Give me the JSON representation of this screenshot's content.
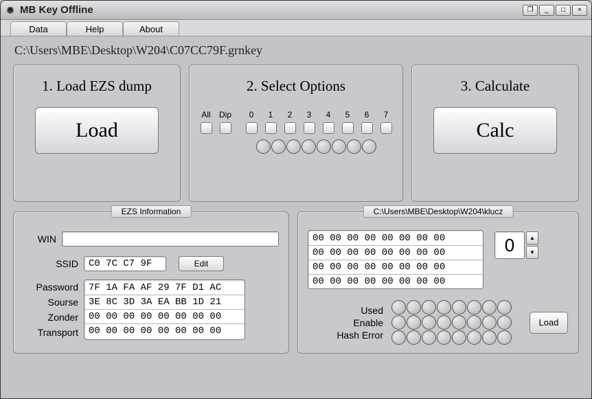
{
  "window": {
    "title": "MB Key Offline",
    "buttons": {
      "b1": "❐",
      "min": "_",
      "max": "□",
      "close": "×"
    }
  },
  "menu": {
    "data": "Data",
    "help": "Help",
    "about": "About"
  },
  "path": "C:\\Users\\MBE\\Desktop\\W204\\C07CC79F.grnkey",
  "panels": {
    "load": {
      "title": "1. Load EZS dump",
      "button": "Load"
    },
    "opts": {
      "title": "2. Select Options",
      "heads": {
        "all": "All",
        "dip": "Dip",
        "n0": "0",
        "n1": "1",
        "n2": "2",
        "n3": "3",
        "n4": "4",
        "n5": "5",
        "n6": "6",
        "n7": "7"
      }
    },
    "calc": {
      "title": "3. Calculate",
      "button": "Calc"
    }
  },
  "ezs": {
    "group_title": "EZS Information",
    "labels": {
      "win": "WIN",
      "ssid": "SSID",
      "password": "Password",
      "sourse": "Sourse",
      "zonder": "Zonder",
      "transport": "Transport",
      "edit": "Edit"
    },
    "win": "",
    "ssid": "C0 7C C7 9F",
    "password": "7F 1A FA AF 29 7F D1 AC",
    "sourse": "3E 8C 3D 3A EA BB 1D 21",
    "zonder": "00 00 00 00 00 00 00 00",
    "transport": "00 00 00 00 00 00 00 00"
  },
  "klucz": {
    "group_title": "C:\\Users\\MBE\\Desktop\\W204\\klucz",
    "rows": {
      "r0": "00 00 00 00 00 00 00 00",
      "r1": "00 00 00 00 00 00 00 00",
      "r2": "00 00 00 00 00 00 00 00",
      "r3": "00 00 00 00 00 00 00 00"
    },
    "spinner": "0",
    "labels": {
      "used": "Used",
      "enable": "Enable",
      "hash_error": "Hash Error",
      "load": "Load"
    }
  }
}
